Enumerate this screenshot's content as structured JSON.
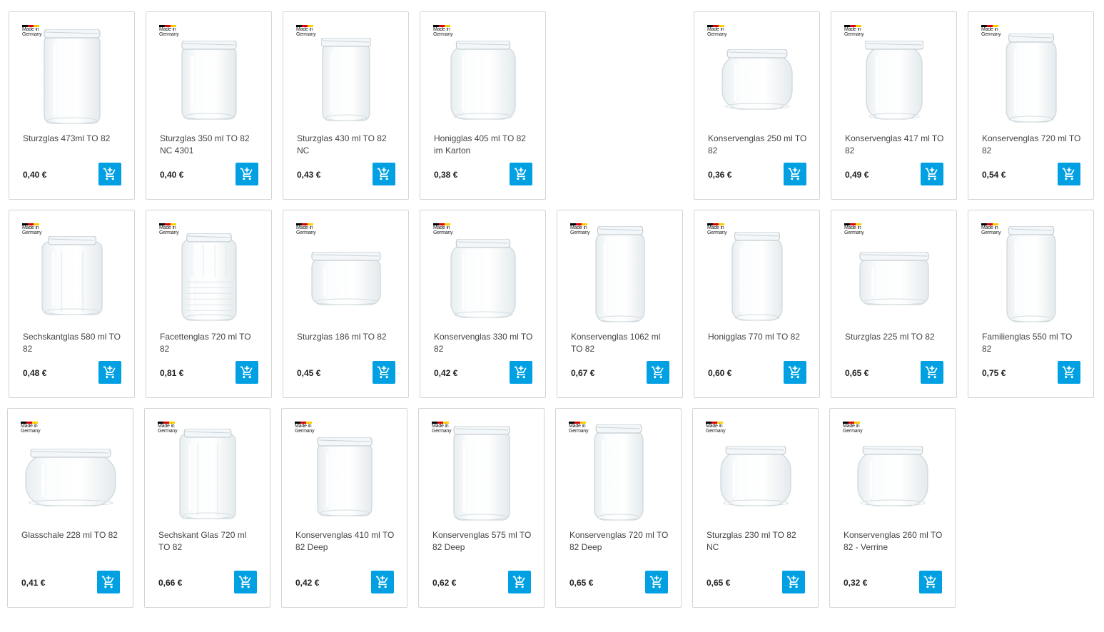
{
  "badge": {
    "line1": "Made in",
    "line2": "Germany"
  },
  "accent_color": "#00a0e3",
  "cart_icon": "add-to-cart-icon",
  "products": [
    {
      "name": "Sturzglas 473ml TO 82",
      "price": "0,40 €",
      "shape": "tall-straight"
    },
    {
      "name": "Sturzglas 350 ml TO 82 NC 4301",
      "price": "0,40 €",
      "shape": "straight"
    },
    {
      "name": "Sturzglas 430 ml TO 82 NC",
      "price": "0,43 €",
      "shape": "slim-straight"
    },
    {
      "name": "Honigglas 405 ml TO 82 im Karton",
      "price": "0,38 €",
      "shape": "wide-round"
    },
    {
      "name": "Konservenglas 250 ml TO 82",
      "price": "0,36 €",
      "shape": "bulb-low"
    },
    {
      "name": "Konservenglas 417 ml TO 82",
      "price": "0,49 €",
      "shape": "tulip"
    },
    {
      "name": "Konservenglas 720 ml TO 82",
      "price": "0,54 €",
      "shape": "tall-round"
    },
    {
      "name": "Sechskantglas 580 ml TO 82",
      "price": "0,48 €",
      "shape": "hexagon"
    },
    {
      "name": "Facettenglas 720 ml TO 82",
      "price": "0,81 €",
      "shape": "facet"
    },
    {
      "name": "Sturzglas 186 ml TO 82",
      "price": "0,45 €",
      "shape": "low-wide"
    },
    {
      "name": "Konservenglas 330 ml TO 82",
      "price": "0,42 €",
      "shape": "wide-round"
    },
    {
      "name": "Konservenglas 1062 ml TO 82",
      "price": "0,67 €",
      "shape": "very-tall"
    },
    {
      "name": "Honigglas 770 ml TO 82",
      "price": "0,60 €",
      "shape": "tall-round"
    },
    {
      "name": "Sturzglas 225 ml TO 82",
      "price": "0,65 €",
      "shape": "low-wide"
    },
    {
      "name": "Familienglas 550 ml TO 82",
      "price": "0,75 €",
      "shape": "very-tall"
    },
    {
      "name": "Glasschale 228 ml TO 82",
      "price": "0,41 €",
      "shape": "bowl"
    },
    {
      "name": "Sechskant Glas 720 ml TO 82",
      "price": "0,66 €",
      "shape": "hexagon-tall"
    },
    {
      "name": "Konservenglas 410 ml TO 82 Deep",
      "price": "0,42 €",
      "shape": "straight"
    },
    {
      "name": "Konservenglas 575 ml TO 82 Deep",
      "price": "0,62 €",
      "shape": "tall-straight"
    },
    {
      "name": "Konservenglas 720 ml TO 82 Deep",
      "price": "0,65 €",
      "shape": "very-tall"
    },
    {
      "name": "Sturzglas 230 ml TO 82 NC",
      "price": "0,65 €",
      "shape": "bulb-low"
    },
    {
      "name": "Konservenglas 260 ml TO 82 - Verrine",
      "price": "0,32 €",
      "shape": "bulb-low"
    }
  ]
}
